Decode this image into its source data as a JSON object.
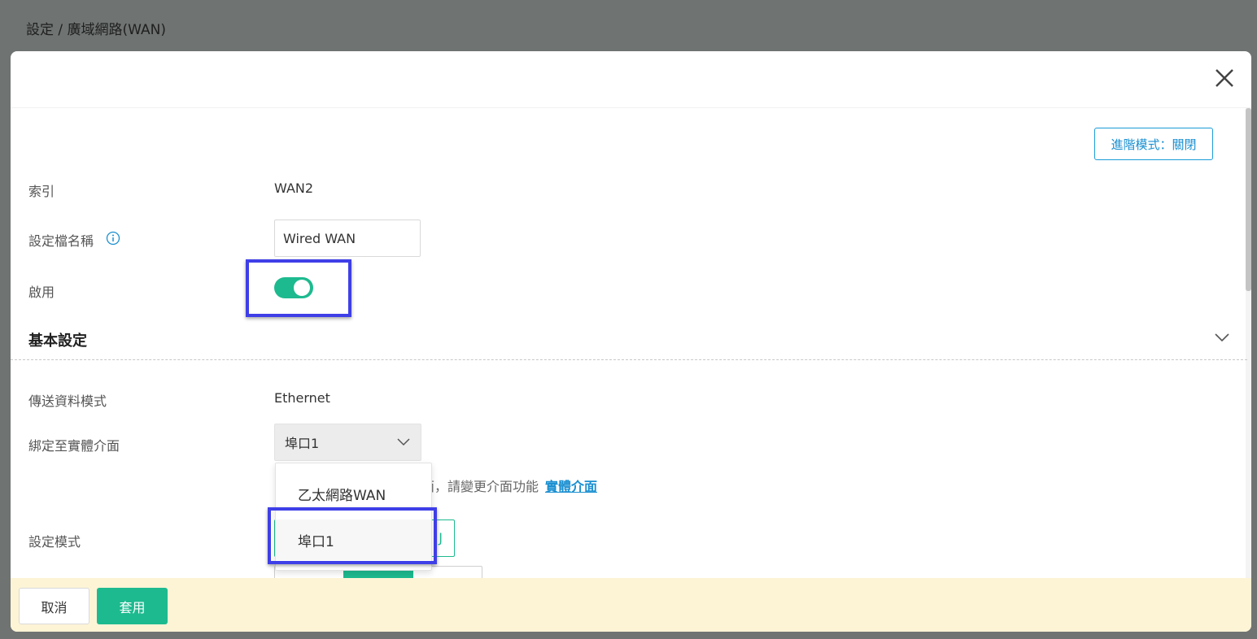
{
  "breadcrumb": "設定 / 廣域網路(WAN)",
  "advanced_mode_label": "進階模式：關閉",
  "fields": {
    "index_label": "索引",
    "index_value": "WAN2",
    "profile_name_label": "設定檔名稱",
    "profile_name_value": "Wired WAN",
    "enable_label": "啟用",
    "enable_state": "on"
  },
  "basic_section": {
    "title": "基本設定",
    "transfer_mode_label": "傳送資料模式",
    "transfer_mode_value": "Ethernet",
    "bind_label": "綁定至實體介面",
    "bind_selected": "埠口1",
    "hint_text": "面，請變更介面功能",
    "hint_link": "實體介面",
    "config_mode_label": "設定模式",
    "config_mode_partial": "J"
  },
  "dropdown": {
    "options": [
      "乙太網路WAN",
      "埠口1"
    ],
    "selected_index": 1
  },
  "footer": {
    "cancel_label": "取消",
    "apply_label": "套用"
  },
  "colors": {
    "accent_green": "#1dba8f",
    "link_blue": "#1a8fd0",
    "highlight": "#3f3fe8",
    "footer_bg": "#fdf4d6"
  }
}
